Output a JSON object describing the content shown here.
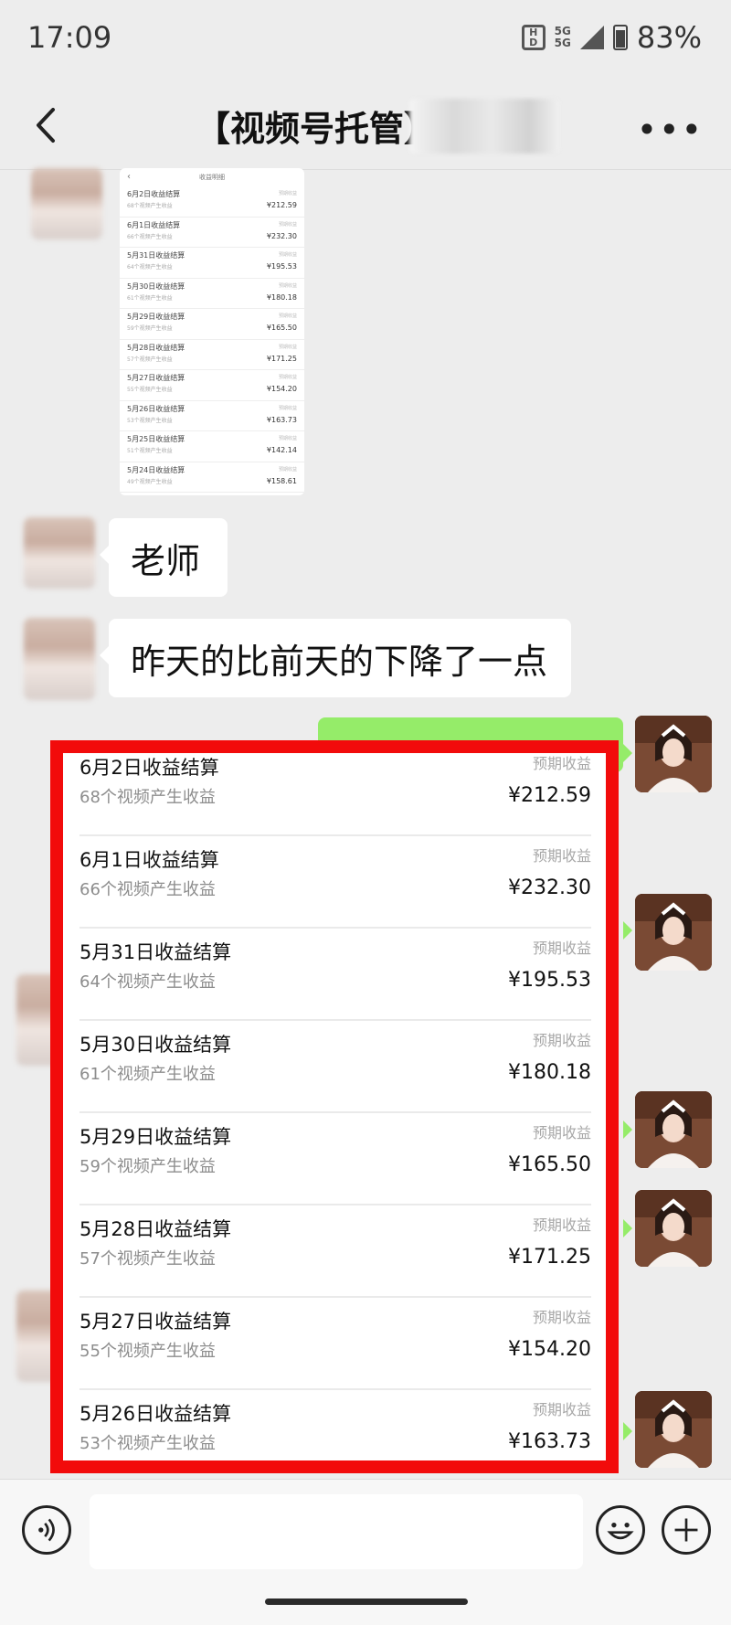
{
  "status_bar": {
    "time": "17:09",
    "hd_label": "HD",
    "network_label": "5G 5G",
    "battery": "83%"
  },
  "header": {
    "title": "【视频号托管】",
    "back_icon": "chevron-left-icon",
    "more_icon": "more-dots-icon"
  },
  "messages": [
    {
      "side": "left",
      "type": "image"
    },
    {
      "side": "left",
      "type": "text",
      "text": "老师"
    },
    {
      "side": "left",
      "type": "text",
      "text": "昨天的比前天的下降了一点"
    }
  ],
  "shared_screenshot": {
    "title": "收益明细",
    "rows": [
      {
        "title": "6月2日收益结算",
        "sub": "68个视频产生收益",
        "tag": "预期收益",
        "amount": "¥212.59"
      },
      {
        "title": "6月1日收益结算",
        "sub": "66个视频产生收益",
        "tag": "预期收益",
        "amount": "¥232.30"
      },
      {
        "title": "5月31日收益结算",
        "sub": "64个视频产生收益",
        "tag": "预期收益",
        "amount": "¥195.53"
      },
      {
        "title": "5月30日收益结算",
        "sub": "61个视频产生收益",
        "tag": "预期收益",
        "amount": "¥180.18"
      },
      {
        "title": "5月29日收益结算",
        "sub": "59个视频产生收益",
        "tag": "预期收益",
        "amount": "¥165.50"
      },
      {
        "title": "5月28日收益结算",
        "sub": "57个视频产生收益",
        "tag": "预期收益",
        "amount": "¥171.25"
      },
      {
        "title": "5月27日收益结算",
        "sub": "55个视频产生收益",
        "tag": "预期收益",
        "amount": "¥154.20"
      },
      {
        "title": "5月26日收益结算",
        "sub": "53个视频产生收益",
        "tag": "预期收益",
        "amount": "¥163.73"
      },
      {
        "title": "5月25日收益结算",
        "sub": "51个视频产生收益",
        "tag": "预期收益",
        "amount": "¥142.14"
      },
      {
        "title": "5月24日收益结算",
        "sub": "49个视频产生收益",
        "tag": "预期收益",
        "amount": "¥158.61"
      }
    ]
  },
  "income_list": [
    {
      "title": "6月2日收益结算",
      "sub": "68个视频产生收益",
      "tag": "预期收益",
      "amount": "¥212.59"
    },
    {
      "title": "6月1日收益结算",
      "sub": "66个视频产生收益",
      "tag": "预期收益",
      "amount": "¥232.30"
    },
    {
      "title": "5月31日收益结算",
      "sub": "64个视频产生收益",
      "tag": "预期收益",
      "amount": "¥195.53"
    },
    {
      "title": "5月30日收益结算",
      "sub": "61个视频产生收益",
      "tag": "预期收益",
      "amount": "¥180.18"
    },
    {
      "title": "5月29日收益结算",
      "sub": "59个视频产生收益",
      "tag": "预期收益",
      "amount": "¥165.50"
    },
    {
      "title": "5月28日收益结算",
      "sub": "57个视频产生收益",
      "tag": "预期收益",
      "amount": "¥171.25"
    },
    {
      "title": "5月27日收益结算",
      "sub": "55个视频产生收益",
      "tag": "预期收益",
      "amount": "¥154.20"
    },
    {
      "title": "5月26日收益结算",
      "sub": "53个视频产生收益",
      "tag": "预期收益",
      "amount": "¥163.73"
    }
  ],
  "input_bar": {
    "voice_icon": "voice-icon",
    "emoji_icon": "emoji-icon",
    "plus_icon": "plus-icon",
    "placeholder": ""
  },
  "colors": {
    "background": "#ededed",
    "bubble_self": "#95ec69",
    "highlight_box": "#f20b0b"
  }
}
